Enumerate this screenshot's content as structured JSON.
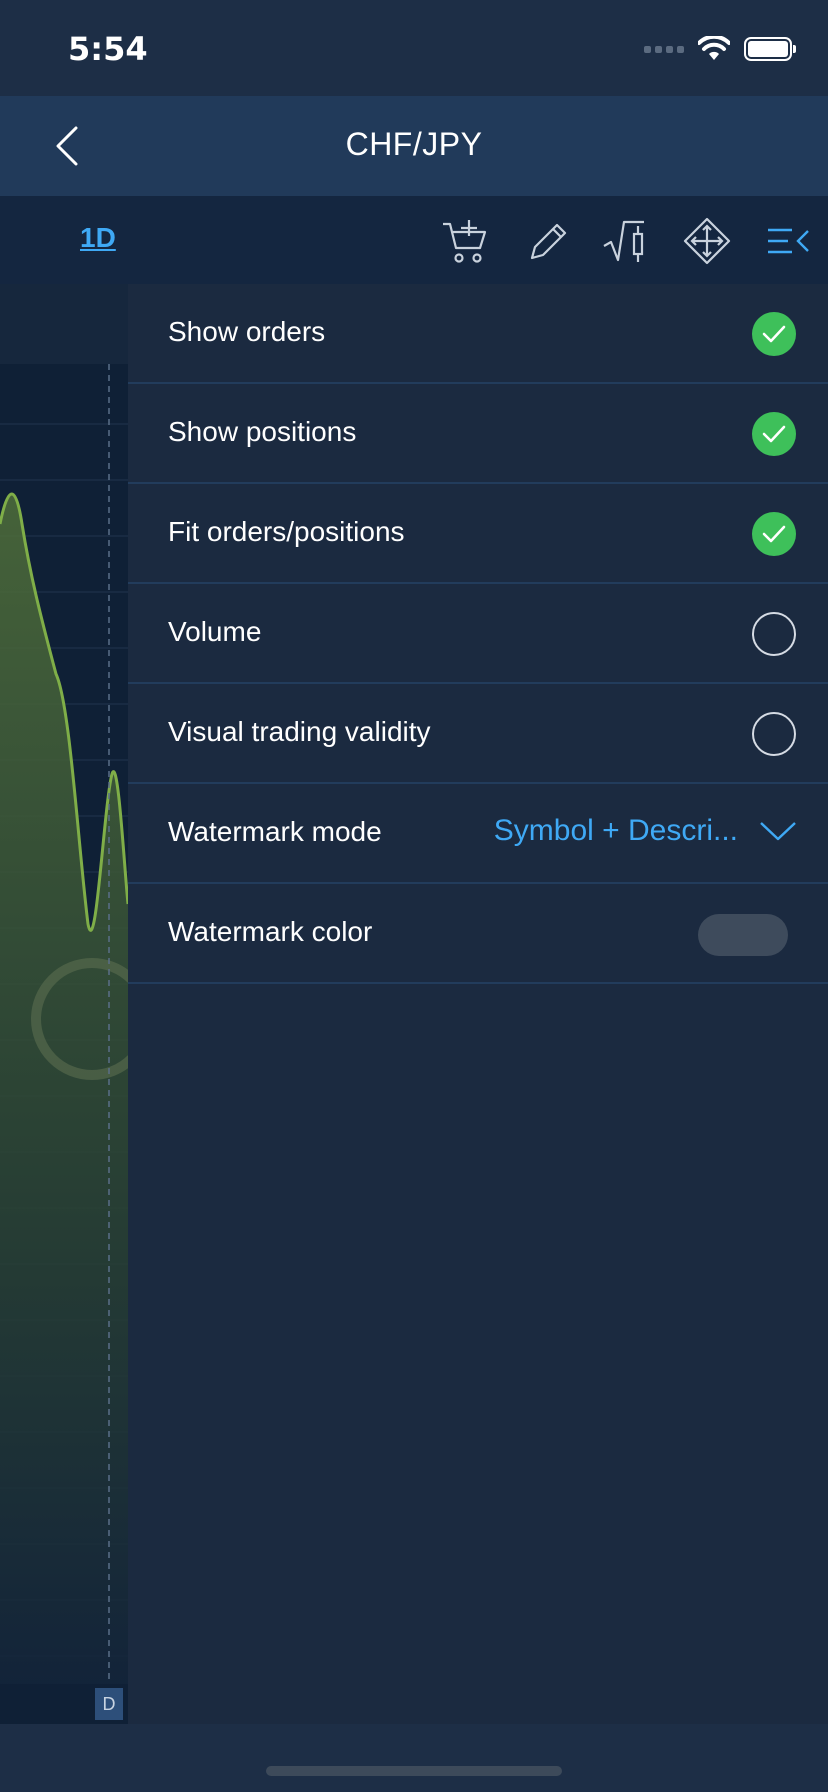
{
  "status_bar": {
    "time": "5:54"
  },
  "nav": {
    "title": "CHF/JPY"
  },
  "toolbar": {
    "timeframe": "1D",
    "tools": [
      "add-order-icon",
      "pencil-icon",
      "chart-type-icon",
      "move-icon",
      "settings-menu-icon"
    ]
  },
  "chart": {
    "marker_label": "D",
    "line_color": "#7fae48"
  },
  "settings": {
    "items": [
      {
        "label": "Show orders",
        "checked": true
      },
      {
        "label": "Show positions",
        "checked": true
      },
      {
        "label": "Fit orders/positions",
        "checked": true
      },
      {
        "label": "Volume",
        "checked": false
      },
      {
        "label": "Visual trading validity",
        "checked": false
      }
    ],
    "watermark_mode": {
      "label": "Watermark mode",
      "value": "Symbol +  Descri..."
    },
    "watermark_color": {
      "label": "Watermark color",
      "color": "#3e4b5c"
    }
  },
  "colors": {
    "accent": "#3fa9f5",
    "check": "#3ec05a",
    "background": "#1b2a40"
  }
}
